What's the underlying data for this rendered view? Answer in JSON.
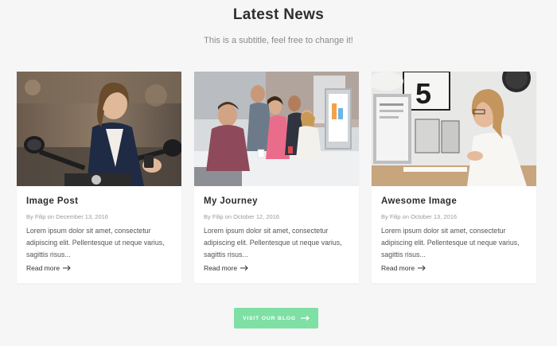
{
  "section": {
    "title": "Latest News",
    "subtitle": "This is a subtitle, feel free to change it!"
  },
  "posts": [
    {
      "title": "Image Post",
      "meta": "By Filip on December 13, 2016",
      "excerpt": "Lorem ipsum dolor sit amet, consectetur adipiscing elit. Pellentesque ut neque varius, sagittis risus...",
      "read_more": "Read more",
      "image": "woman-on-scooter-photo"
    },
    {
      "title": "My Journey",
      "meta": "By Filip on October 12, 2016",
      "excerpt": "Lorem ipsum dolor sit amet, consectetur adipiscing elit. Pellentesque ut neque varius, sagittis risus...",
      "read_more": "Read more",
      "image": "team-meeting-photo"
    },
    {
      "title": "Awesome Image",
      "meta": "By Filip on October 13, 2016",
      "excerpt": "Lorem ipsum dolor sit amet, consectetur adipiscing elit. Pellentesque ut neque varius, sagittis risus...",
      "read_more": "Read more",
      "image": "woman-at-desk-photo"
    }
  ],
  "cta": {
    "label": "VISIT OUR BLOG"
  },
  "colors": {
    "background": "#f6f6f6",
    "card": "#ffffff",
    "accent": "#7ee0a4"
  }
}
